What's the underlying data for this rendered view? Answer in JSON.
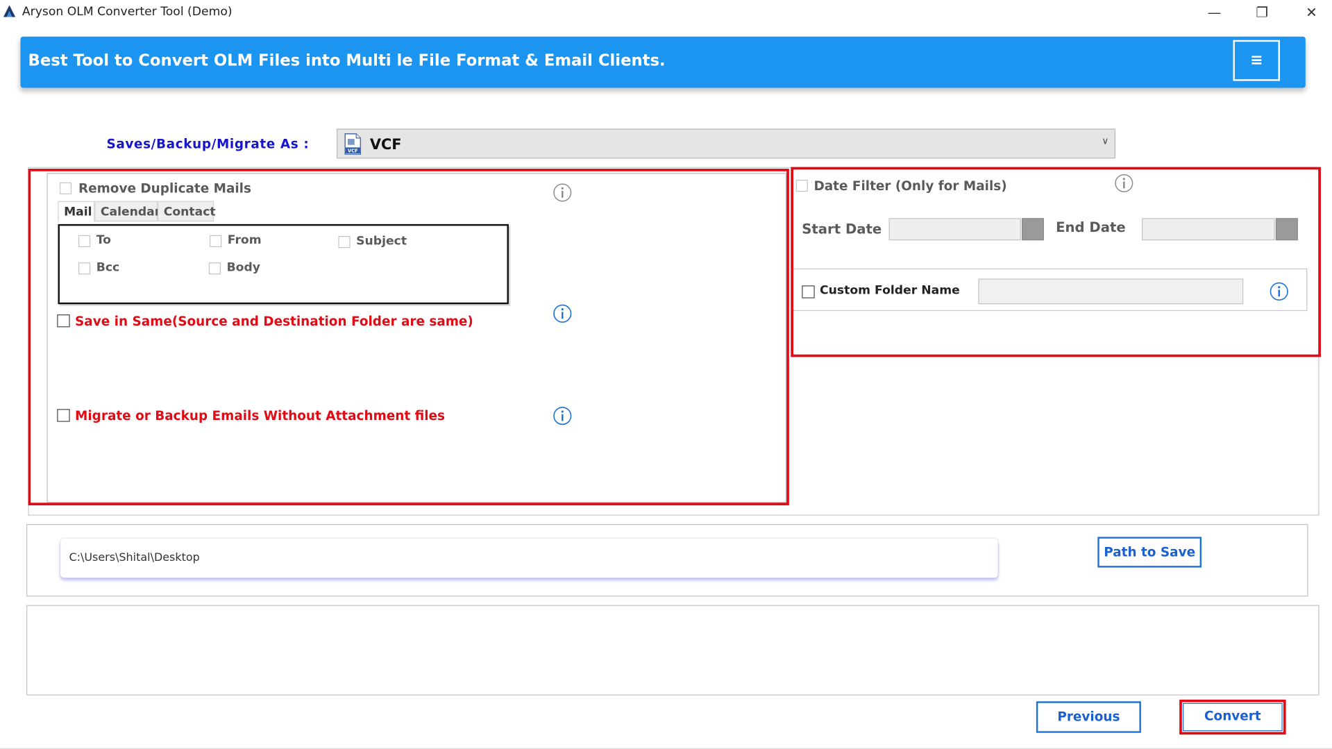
{
  "window": {
    "title": "Aryson OLM Converter Tool (Demo)",
    "controls": {
      "minimize": "—",
      "restore": "❐",
      "close": "✕"
    }
  },
  "banner": {
    "title": "Best Tool to Convert OLM Files into Multi le File Format & Email Clients.",
    "menu_icon": "≡",
    "color": "#1b95f0"
  },
  "save_as": {
    "label": "Saves/Backup/Migrate As :",
    "selected": "VCF",
    "icon": "vcf-file-icon"
  },
  "left_options": {
    "remove_duplicates": {
      "label": "Remove Duplicate Mails",
      "checked": false,
      "enabled": false
    },
    "tabs": [
      {
        "label": "Mail",
        "active": true
      },
      {
        "label": "Calendar",
        "active": false
      },
      {
        "label": "Contact",
        "active": false
      }
    ],
    "fields": {
      "to": "To",
      "from": "From",
      "subject": "Subject",
      "bcc": "Bcc",
      "body": "Body"
    },
    "save_in_same": {
      "label": "Save in Same(Source and Destination Folder are same)",
      "checked": false
    },
    "without_attachments": {
      "label": "Migrate or Backup Emails Without Attachment files",
      "checked": false
    }
  },
  "right_options": {
    "date_filter": {
      "label": "Date Filter  (Only for Mails)",
      "checked": false,
      "enabled": false
    },
    "start_date_label": "Start Date",
    "end_date_label": "End Date",
    "custom_folder": {
      "label": "Custom Folder Name",
      "checked": false,
      "value": ""
    }
  },
  "path": {
    "value": "C:\\Users\\Shital\\Desktop",
    "button": "Path to Save"
  },
  "footer": {
    "previous": "Previous",
    "convert": "Convert"
  },
  "colors": {
    "highlight_red": "#e00b14",
    "label_blue": "#1515c9",
    "button_blue": "#1b5fd0"
  }
}
